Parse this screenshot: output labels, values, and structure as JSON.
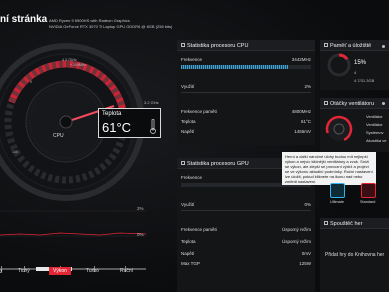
{
  "header": {
    "title": "ní stránka",
    "cpu_name": "AMD Ryzen 9 5900HS with Radeon Graphics",
    "gpu_name": "NVIDIA GeForce RTX 3070 Ti Laptop GPU GDDR6 @ 8GB (256 bits)"
  },
  "gauge": {
    "scale_max": "4 3.7GHz",
    "scale_label": "+ 100MHz",
    "scale_0": "0",
    "scale_1": "100",
    "cpu_label": "CPU",
    "header_tag": "3.2 GHz",
    "temp_title": "Teplota",
    "temp_value": "61°C",
    "accent": "#e32636"
  },
  "mini_chart": {
    "pct_high": "2%",
    "pct_low": "0%"
  },
  "modes": {
    "tabs": [
      {
        "label": "Tichý",
        "active": false
      },
      {
        "label": "Výkon",
        "active": true
      },
      {
        "label": "Turbo",
        "active": false
      },
      {
        "label": "Ruční",
        "active": false
      }
    ],
    "left_label": "ž"
  },
  "cpu_panel": {
    "title": "Statistika procesoru CPU",
    "freq_label": "Frekvence",
    "freq_value": "3442MHz",
    "freq_fill_fraction": 0.82,
    "usage_label": "Využití",
    "usage_value": "2%",
    "mem_freq_label": "Frekvence paměti",
    "mem_freq_value": "4800MHz",
    "temp_label": "Teplota",
    "temp_value": "61°C",
    "voltage_label": "Napětí",
    "voltage_value": "1455mV"
  },
  "gpu_panel": {
    "title": "Statistika procesoru GPU",
    "freq_label": "Frekvence",
    "freq_value": "0MHz",
    "usage_label": "Využití",
    "usage_value": "0%",
    "mem_freq_label": "Frekvence paměti",
    "mem_freq_value": "Úsporný režim",
    "temp_label": "Teplota",
    "temp_value": "Úsporný režim",
    "voltage_label": "Napětí",
    "voltage_value": "0mV",
    "tgp_label": "Max TGP",
    "tgp_value": "125W"
  },
  "memory_panel": {
    "title": "Paměť a úložiště",
    "percent": "15%",
    "unit": "4",
    "detail": "4.7/31.3GB"
  },
  "fan_panel": {
    "title": "Otáčky ventilátoru",
    "lines": [
      "Ventilátor",
      "Ventilátor",
      "Systémov",
      "Akustika ve"
    ]
  },
  "tooltip": {
    "text": "Herní a další náročné úlohy budou mít nejlepší výkon a nejvíc klidnější ventilátory a zvuk. Sníží se výkon, ale zlepší se provozní výdrž a projeví se ve výkonu aktuální podmínky. Ruční nastavení lze uložit, pokud kliknete na ikonu nad nebo změnit nastavení."
  },
  "mode_icons": {
    "items": [
      {
        "label": "Ultimate",
        "color": "#2fb4f0"
      },
      {
        "label": "Standard",
        "color": "#e32636"
      }
    ]
  },
  "shortcut_panel": {
    "title": "Spouštěč her",
    "hint": "Přidat hry do Knihovna her"
  }
}
